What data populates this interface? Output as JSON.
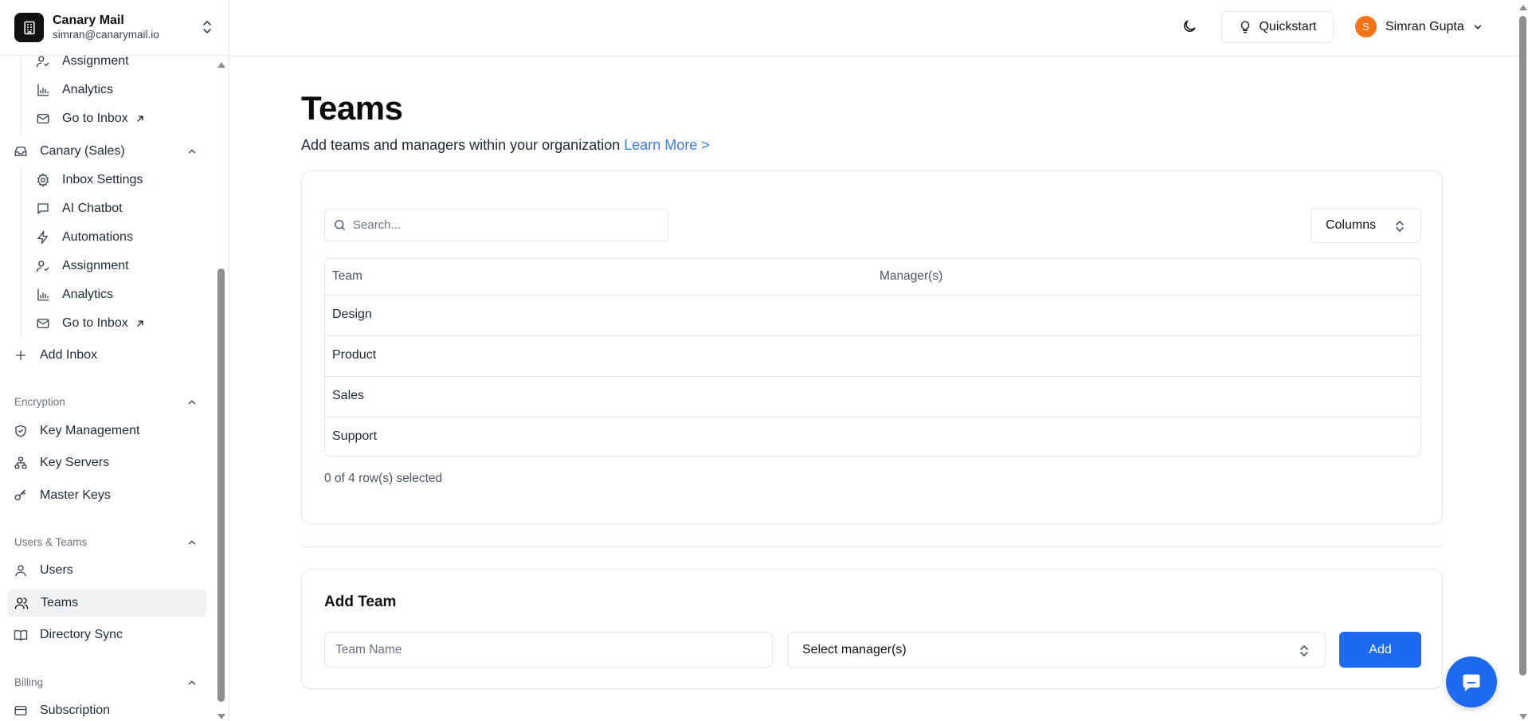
{
  "brand": {
    "name": "Canary Mail",
    "email": "simran@canarymail.io"
  },
  "sidebar": {
    "inbox1_items": [
      {
        "label": "Assignment",
        "icon": "user-check-icon"
      },
      {
        "label": "Analytics",
        "icon": "bar-chart-icon"
      },
      {
        "label": "Go to Inbox",
        "icon": "mail-icon"
      }
    ],
    "inbox2": {
      "label": "Canary (Sales)",
      "items": [
        {
          "label": "Inbox Settings",
          "icon": "gear-icon"
        },
        {
          "label": "AI Chatbot",
          "icon": "message-square-icon"
        },
        {
          "label": "Automations",
          "icon": "lightning-icon"
        },
        {
          "label": "Assignment",
          "icon": "user-check-icon"
        },
        {
          "label": "Analytics",
          "icon": "bar-chart-icon"
        },
        {
          "label": "Go to Inbox",
          "icon": "mail-icon"
        }
      ]
    },
    "add_inbox": "Add Inbox",
    "encryption": {
      "title": "Encryption",
      "items": [
        {
          "label": "Key Management",
          "icon": "shield-check-icon"
        },
        {
          "label": "Key Servers",
          "icon": "network-icon"
        },
        {
          "label": "Master Keys",
          "icon": "key-icon"
        }
      ]
    },
    "users_teams": {
      "title": "Users & Teams",
      "items": [
        {
          "label": "Users",
          "icon": "user-icon"
        },
        {
          "label": "Teams",
          "icon": "users-icon"
        },
        {
          "label": "Directory Sync",
          "icon": "book-open-icon"
        }
      ]
    },
    "billing": {
      "title": "Billing",
      "items": [
        {
          "label": "Subscription",
          "icon": "credit-card-icon"
        }
      ]
    },
    "active_item": "Teams"
  },
  "header": {
    "quickstart_label": "Quickstart",
    "user_initial": "S",
    "user_name": "Simran Gupta",
    "accent": "#f97316"
  },
  "main": {
    "title": "Teams",
    "subtitle": "Add teams and managers within your organization",
    "learn_more": "Learn More >",
    "search_placeholder": "Search...",
    "columns_label": "Columns",
    "table": {
      "headers": [
        "Team",
        "Manager(s)"
      ],
      "rows": [
        {
          "team": "Design",
          "managers": ""
        },
        {
          "team": "Product",
          "managers": ""
        },
        {
          "team": "Sales",
          "managers": ""
        },
        {
          "team": "Support",
          "managers": ""
        }
      ]
    },
    "row_count": "0 of 4 row(s) selected"
  },
  "add_team": {
    "title": "Add Team",
    "name_placeholder": "Team Name",
    "manager_select": "Select manager(s)",
    "add_label": "Add",
    "button_color": "#1d6af0"
  }
}
